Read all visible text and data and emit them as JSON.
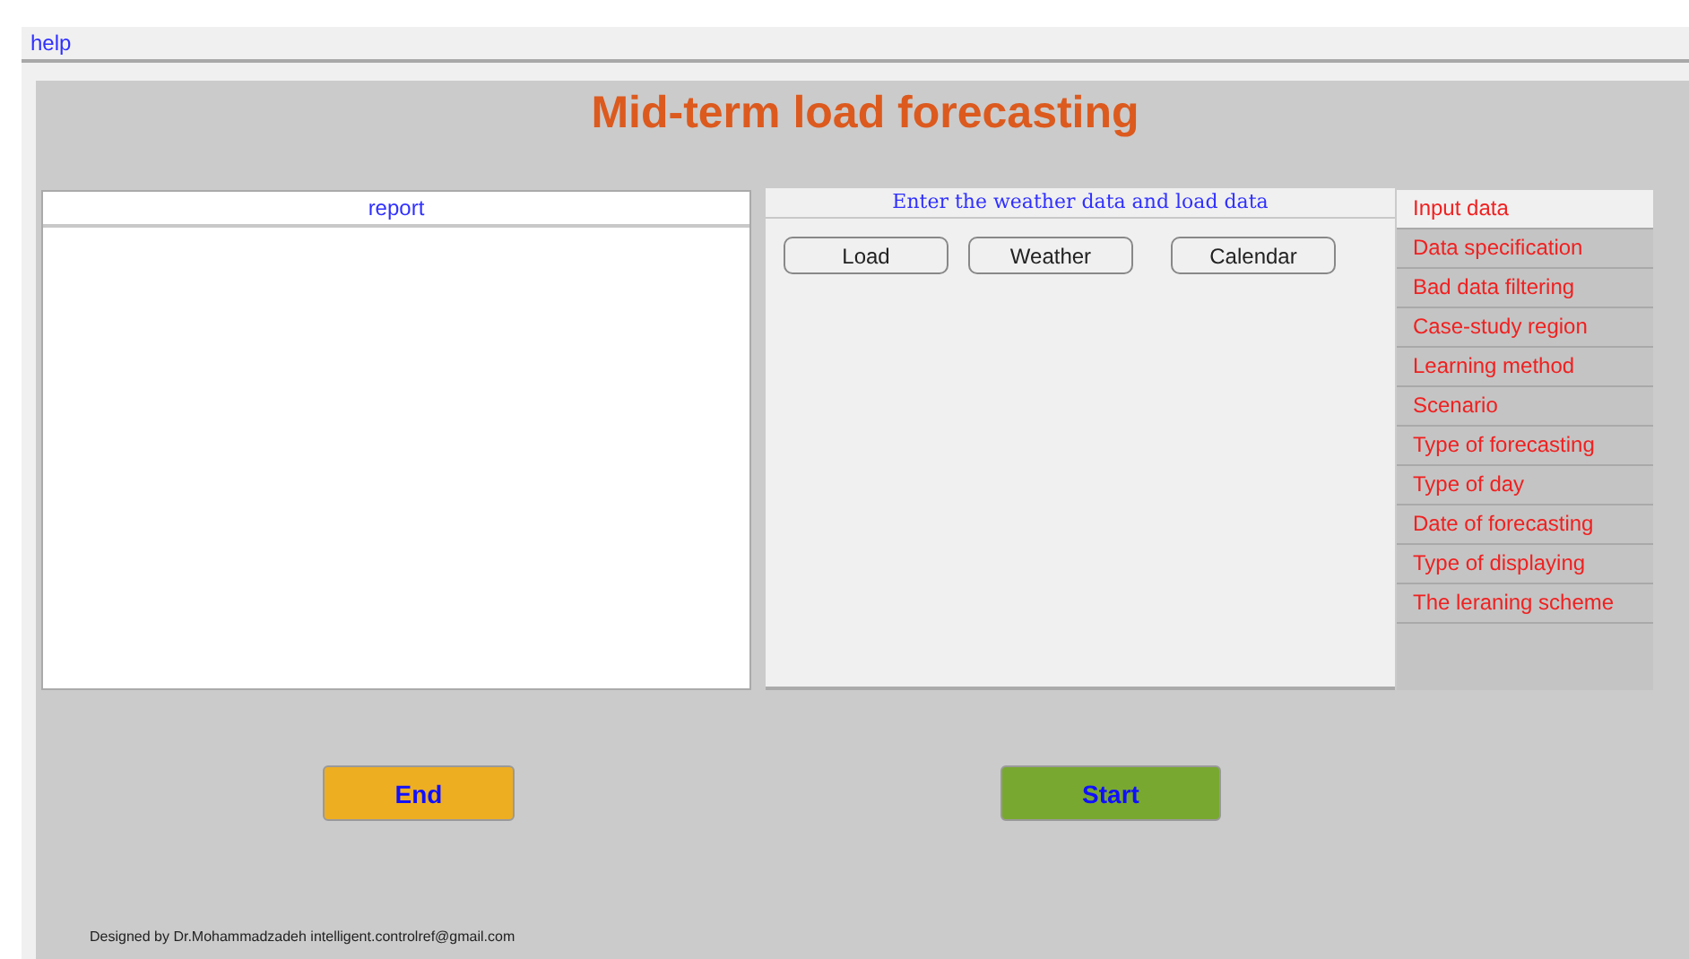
{
  "menu": [
    "help"
  ],
  "title": "Mid-term load forecasting",
  "report": {
    "title": "report"
  },
  "panel": {
    "title": "Enter the weather data and load data",
    "buttons": [
      "Load",
      "Weather",
      "Calendar"
    ]
  },
  "tabs": [
    {
      "label": "Input data",
      "selected": true
    },
    {
      "label": "Data specification",
      "selected": false
    },
    {
      "label": "Bad data filtering",
      "selected": false
    },
    {
      "label": "Case-study region",
      "selected": false
    },
    {
      "label": "Learning method",
      "selected": false
    },
    {
      "label": "Scenario",
      "selected": false
    },
    {
      "label": "Type of forecasting",
      "selected": false
    },
    {
      "label": "Type of day",
      "selected": false
    },
    {
      "label": "Date of forecasting",
      "selected": false
    },
    {
      "label": "Type of displaying",
      "selected": false
    },
    {
      "label": "The leraning scheme",
      "selected": false
    }
  ],
  "actions": [
    {
      "label": "End",
      "kind": "end"
    },
    {
      "label": "Start",
      "kind": "start"
    }
  ],
  "footer": "Designed by Dr.Mohammadzadeh intelligent.controlref@gmail.com"
}
